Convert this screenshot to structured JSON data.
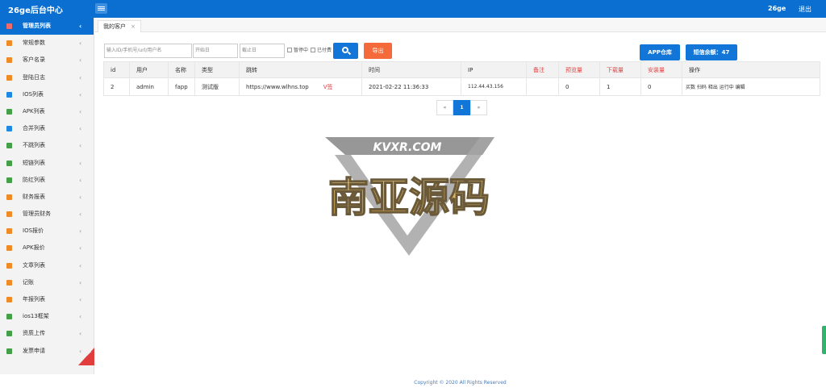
{
  "header": {
    "brand": "26ge后台中心",
    "user": "26ge",
    "logout": "退出"
  },
  "sidebar": {
    "items": [
      {
        "label": "管理员列表",
        "icon": "users-icon",
        "color": "#f06a6a"
      },
      {
        "label": "常规参数",
        "icon": "plus-icon",
        "color": "#f08a24"
      },
      {
        "label": "客户名录",
        "icon": "briefcase-icon",
        "color": "#f08a24"
      },
      {
        "label": "登陆日志",
        "icon": "log-icon",
        "color": "#f08a24"
      },
      {
        "label": "IOS列表",
        "icon": "apple-icon",
        "color": "#1e88e5"
      },
      {
        "label": "APK列表",
        "icon": "android-icon",
        "color": "#43a047"
      },
      {
        "label": "合并列表",
        "icon": "merge-icon",
        "color": "#1e88e5"
      },
      {
        "label": "不跳列表",
        "icon": "rss-icon",
        "color": "#43a047"
      },
      {
        "label": "短链列表",
        "icon": "rss-icon",
        "color": "#43a047"
      },
      {
        "label": "防红列表",
        "icon": "rss-icon",
        "color": "#43a047"
      },
      {
        "label": "财务报表",
        "icon": "finance-icon",
        "color": "#f08a24"
      },
      {
        "label": "管理员财务",
        "icon": "shield-icon",
        "color": "#f08a24"
      },
      {
        "label": "IOS报价",
        "icon": "pen-icon",
        "color": "#f08a24"
      },
      {
        "label": "APK报价",
        "icon": "list-icon",
        "color": "#f08a24"
      },
      {
        "label": "文章列表",
        "icon": "person-icon",
        "color": "#f08a24"
      },
      {
        "label": "记账",
        "icon": "music-icon",
        "color": "#f08a24"
      },
      {
        "label": "年报列表",
        "icon": "music-icon",
        "color": "#f08a24"
      },
      {
        "label": "ios13框架",
        "icon": "rss-icon",
        "color": "#43a047"
      },
      {
        "label": "资质上传",
        "icon": "rss-icon",
        "color": "#43a047"
      },
      {
        "label": "发票申请",
        "icon": "rss-icon",
        "color": "#43a047"
      }
    ]
  },
  "tabs": [
    {
      "label": "我的客户",
      "close": "×"
    }
  ],
  "filters": {
    "keyword_placeholder": "输入ID/手机号/url/用户名",
    "start_placeholder": "开始日",
    "end_placeholder": "截止日",
    "chk_paused": "暂停中",
    "chk_paid": "已付费",
    "export": "导出"
  },
  "actions": {
    "app_store": "APP仓库",
    "sms_balance": "短信余额：47"
  },
  "table": {
    "headers": [
      "id",
      "用户",
      "名称",
      "类型",
      "跳转",
      "时间",
      "IP",
      "备注",
      "预览量",
      "下载量",
      "安装量",
      "操作"
    ],
    "rows": [
      {
        "id": "2",
        "user": "admin",
        "name": "fapp",
        "type": "测试版",
        "jump": "https://www.wlhns.top",
        "tag": "V签",
        "time": "2021-02-22 11:36:33",
        "ip": "112.44.43.156",
        "note": "",
        "views": "0",
        "downloads": "1",
        "installs": "0",
        "ops": "买数 扫码 释出 运行中 编辑"
      }
    ]
  },
  "pagination": {
    "prev": "«",
    "current": "1",
    "next": "»"
  },
  "watermark": {
    "top": "KVXR.COM",
    "main": "南亚源码"
  },
  "footer": "Copyright © 2020 All Rights Reserved"
}
